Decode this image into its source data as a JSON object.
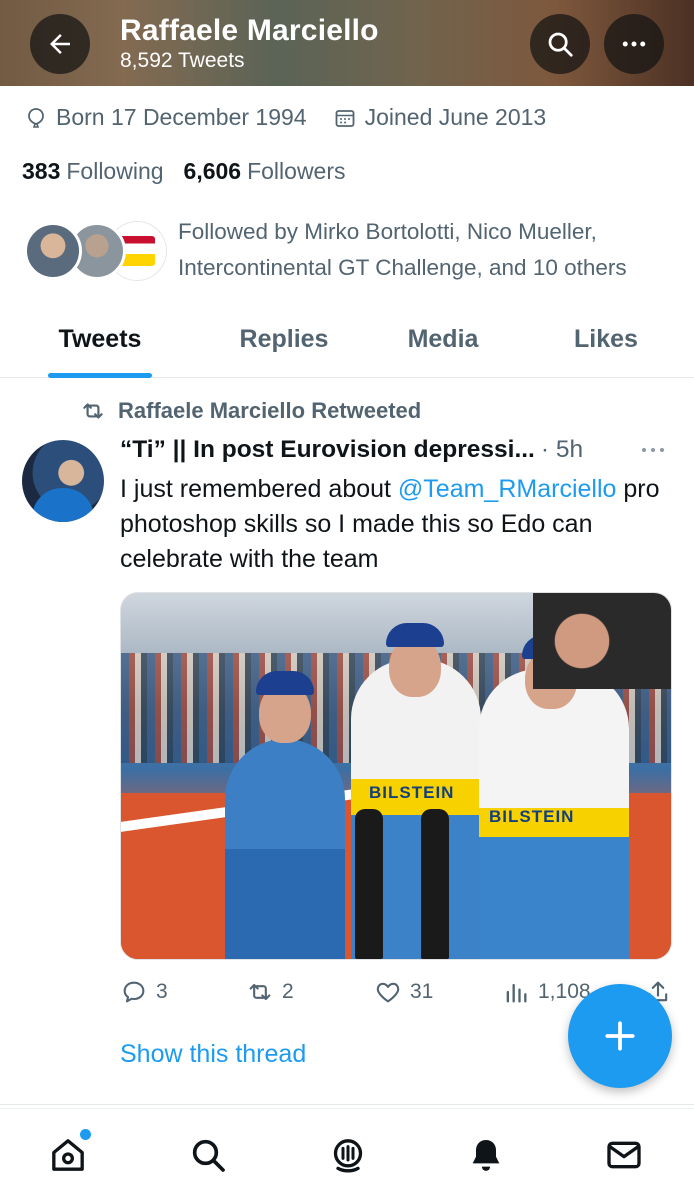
{
  "header": {
    "title": "Raffaele Marciello",
    "subtitle": "8,592 Tweets"
  },
  "profile": {
    "born": "Born 17 December 1994",
    "joined": "Joined June 2013",
    "following_count": "383",
    "following_label": "Following",
    "followers_count": "6,606",
    "followers_label": "Followers",
    "followed_by": "Followed by Mirko Bortolotti, Nico Mueller, Intercontinental GT Challenge, and 10 others"
  },
  "tabs": [
    {
      "label": "Tweets",
      "active": true
    },
    {
      "label": "Replies",
      "active": false
    },
    {
      "label": "Media",
      "active": false
    },
    {
      "label": "Likes",
      "active": false
    }
  ],
  "tweet": {
    "retweeted_by": "Raffaele Marciello Retweeted",
    "author": "“Ti” || In post Eurovision depressi...",
    "time": "· 5h",
    "text_before": "I just remembered about ",
    "mention": "@Team_RMarciello",
    "text_after": " pro photoshop skills so I made this so Edo can celebrate with the team",
    "image_text_1": "BILSTEIN",
    "image_text_2": "BILSTEIN",
    "replies": "3",
    "retweets": "2",
    "likes": "31",
    "views": "1,108",
    "show_thread": "Show this thread"
  },
  "colors": {
    "accent": "#1d9bf0",
    "text_primary": "#0f1419",
    "text_secondary": "#536471"
  },
  "icons": {
    "back": "arrow-left-icon",
    "search": "search-icon",
    "more": "more-icon",
    "born": "balloon-icon",
    "joined": "calendar-icon",
    "retweet": "retweet-icon",
    "compose": "plus-icon",
    "nav": [
      "home-icon",
      "search-icon",
      "spaces-icon",
      "bell-icon",
      "mail-icon"
    ]
  }
}
